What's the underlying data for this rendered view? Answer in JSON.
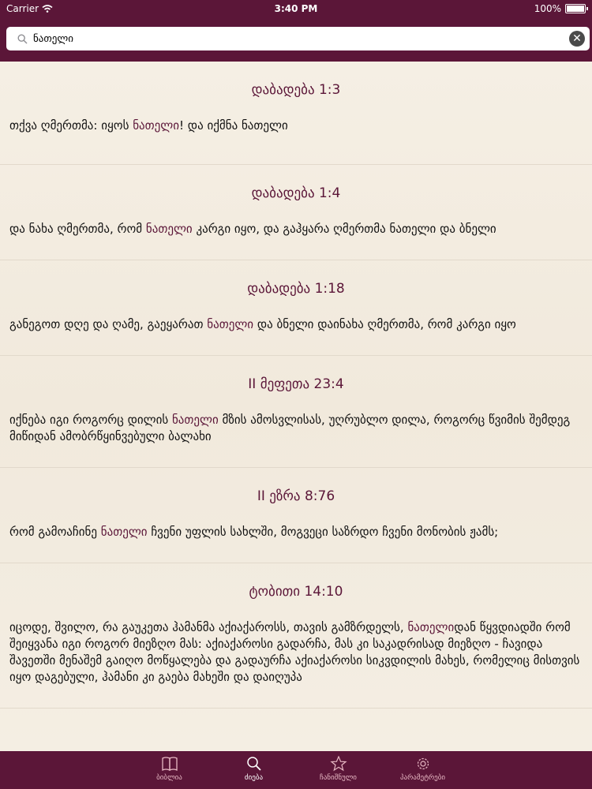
{
  "status": {
    "carrier": "Carrier",
    "time": "3:40 PM",
    "battery": "100%"
  },
  "search": {
    "value": "ნათელი"
  },
  "results": [
    {
      "ref": "დაბადება   1:3",
      "parts": [
        "თქვა ღმერთმა: იყოს ",
        "ნათელი",
        "! და იქმნა ნათელი"
      ]
    },
    {
      "ref": "დაბადება   1:4",
      "parts": [
        "და ნახა ღმერთმა, რომ ",
        "ნათელი",
        " კარგი იყო, და გაჰყარა ღმერთმა ნათელი და ბნელი"
      ]
    },
    {
      "ref": "დაბადება   1:18",
      "parts": [
        " განეგოთ დღე და ღამე, გაეყარათ ",
        "ნათელი",
        " და ბნელი დაინახა ღმერთმა, რომ კარგი იყო"
      ]
    },
    {
      "ref": "II მეფეთა  23:4",
      "parts": [
        "იქნება იგი როგორც დილის ",
        "ნათელი",
        " მზის ამოსვლისას, უღრუბლო დილა, როგორც წვიმის შემდეგ მიწიდან ამობრწყინვებული ბალახი"
      ]
    },
    {
      "ref": "II ეზრა  8:76",
      "parts": [
        " რომ გამოაჩინე ",
        "ნათელი",
        " ჩვენი უფლის სახლში, მოგვეცი საზრდო ჩვენი მონობის ჟამს;"
      ]
    },
    {
      "ref": "ტობითი  14:10",
      "parts": [
        " იცოდე, შვილო, რა გაუკეთა ჰამანმა აქიაქაროსს, თავის გამზრდელს, ",
        "ნათელი",
        "დან წყვდიადში რომ შეიყვანა იგი როგორ მიეზღო მას: აქიაქაროსი გადარჩა, მას კი საკადრისად მიეზღო - ჩავიდა შავეთში მენაშემ გაიღო მოწყალება და გადაურჩა აქიაქაროსი სიკვდილის მახეს, რომელიც მისთვის იყო დაგებული, ჰამანი კი გაება მახეში და დაიღუპა"
      ]
    }
  ],
  "tabs": [
    {
      "label": "ბიბლია",
      "icon": "book-icon"
    },
    {
      "label": "ძიება",
      "icon": "search-icon",
      "active": true
    },
    {
      "label": "ჩანიშნული",
      "icon": "star-icon"
    },
    {
      "label": "პარამეტრები",
      "icon": "gear-icon"
    }
  ]
}
